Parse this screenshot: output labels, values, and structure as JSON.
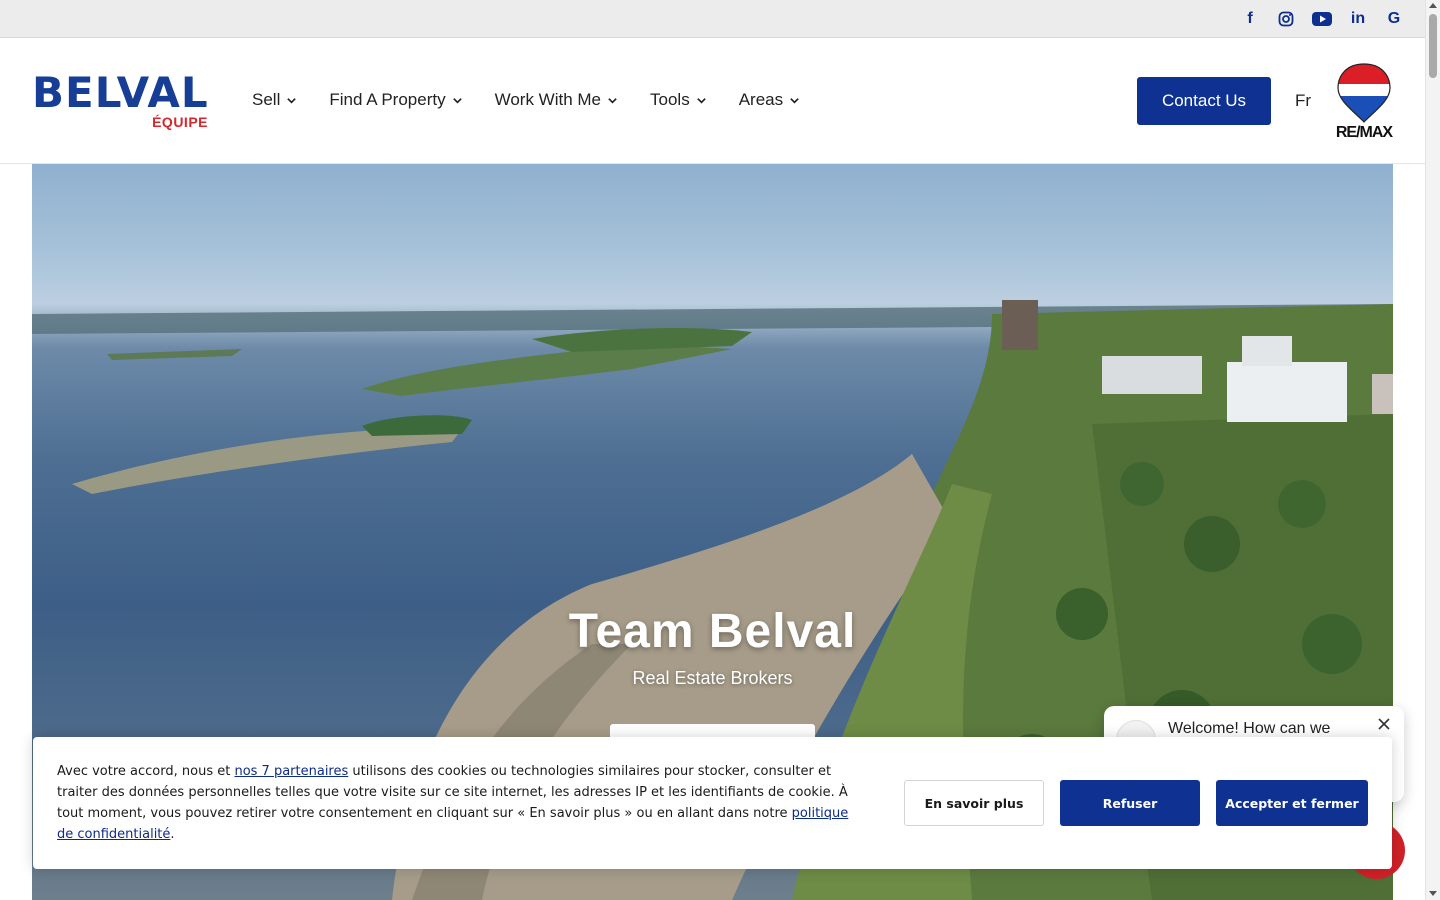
{
  "social": {
    "facebook_glyph": "f",
    "linkedin_glyph": "in",
    "google_glyph": "G"
  },
  "header": {
    "logo_main": "BELVAL",
    "logo_sub": "ÉQUIPE",
    "nav": [
      {
        "label": "Sell"
      },
      {
        "label": "Find A Property"
      },
      {
        "label": "Work With Me"
      },
      {
        "label": "Tools"
      },
      {
        "label": "Areas"
      }
    ],
    "contact_label": "Contact Us",
    "lang_label": "Fr",
    "brand_label": "RE/MAX"
  },
  "hero": {
    "title": "Team Belval",
    "subtitle": "Real Estate Brokers"
  },
  "chat": {
    "welcome": "Welcome! How can we"
  },
  "cookie": {
    "text_before": "Avec votre accord, nous et ",
    "partners_link": "nos 7 partenaires",
    "text_middle": " utilisons des cookies ou technologies similaires pour stocker, consulter et traiter des données personnelles telles que votre visite sur ce site internet, les adresses IP et les identifiants de cookie. À tout moment, vous pouvez retirer votre consentement en cliquant sur « En savoir plus » ou en allant dans notre ",
    "privacy_link": "politique de confidentialité",
    "text_after": ".",
    "more_label": "En savoir plus",
    "refuse_label": "Refuser",
    "accept_label": "Accepter et fermer"
  },
  "colors": {
    "brand_blue": "#0f3192",
    "logo_blue": "#173e96",
    "logo_red": "#d6262e",
    "chat_red": "#d02128"
  }
}
